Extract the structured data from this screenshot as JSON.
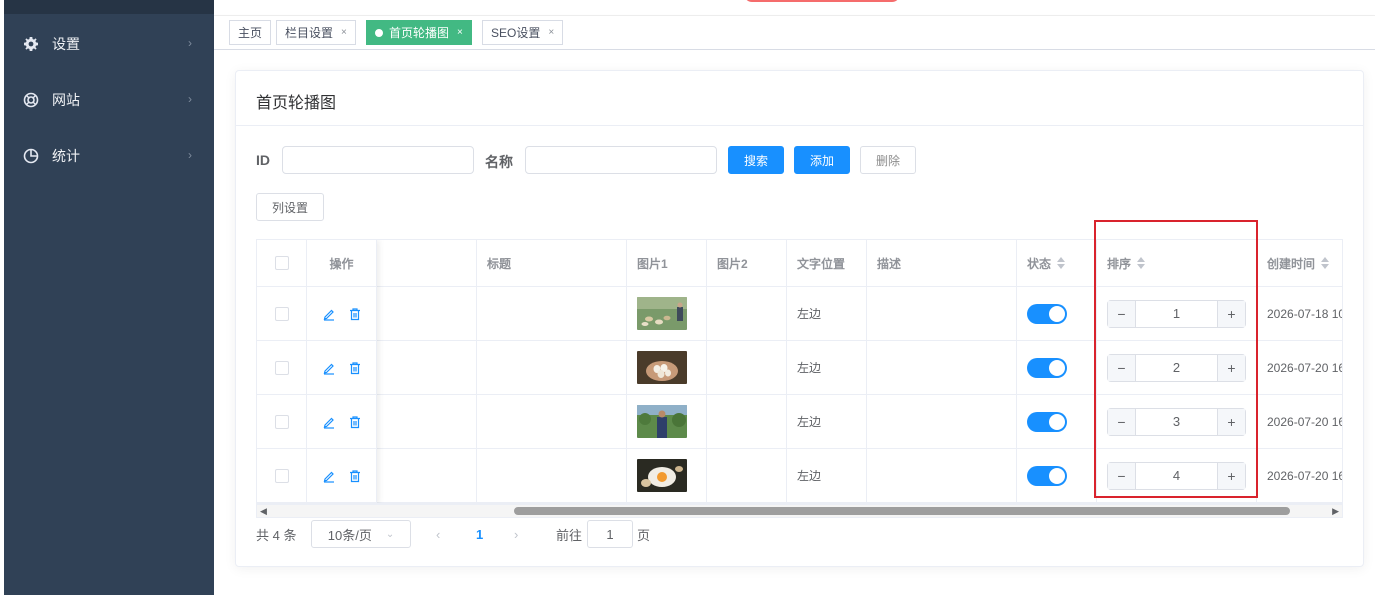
{
  "sidebar": {
    "items": [
      {
        "label": "设置",
        "icon": "gear-icon"
      },
      {
        "label": "网站",
        "icon": "lifebuoy-icon"
      },
      {
        "label": "统计",
        "icon": "pie-chart-icon"
      }
    ]
  },
  "tabs": [
    {
      "label": "主页",
      "closable": false,
      "active": false
    },
    {
      "label": "栏目设置",
      "closable": true,
      "active": false
    },
    {
      "label": "首页轮播图",
      "closable": true,
      "active": true
    },
    {
      "label": "SEO设置",
      "closable": true,
      "active": false
    }
  ],
  "tab_close_glyph": "×",
  "card": {
    "title": "首页轮播图"
  },
  "search": {
    "id_label": "ID",
    "name_label": "名称",
    "id_value": "",
    "name_value": "",
    "search_btn": "搜索",
    "add_btn": "添加",
    "delete_btn": "删除",
    "columns_btn": "列设置"
  },
  "table": {
    "headers": {
      "ops": "操作",
      "title": "标题",
      "img1": "图片1",
      "img2": "图片2",
      "text_pos": "文字位置",
      "desc": "描述",
      "status": "状态",
      "sort": "排序",
      "created": "创建时间"
    },
    "rows": [
      {
        "title": "",
        "img1": "chickens-field",
        "img2": "",
        "text_pos": "左边",
        "desc": "",
        "status": true,
        "sort": "1",
        "created": "2026-07-18 10"
      },
      {
        "title": "",
        "img1": "hands-eggs",
        "img2": "",
        "text_pos": "左边",
        "desc": "",
        "status": true,
        "sort": "2",
        "created": "2026-07-20 16"
      },
      {
        "title": "",
        "img1": "farmer-orchard",
        "img2": "",
        "text_pos": "左边",
        "desc": "",
        "status": true,
        "sort": "3",
        "created": "2026-07-20 16"
      },
      {
        "title": "",
        "img1": "cracked-egg",
        "img2": "",
        "text_pos": "左边",
        "desc": "",
        "status": true,
        "sort": "4",
        "created": "2026-07-20 16"
      }
    ],
    "stepper_minus": "−",
    "stepper_plus": "+"
  },
  "pagination": {
    "total": "共 4 条",
    "page_size": "10条/页",
    "current_page": "1",
    "goto_label": "前往",
    "goto_value": "1",
    "page_suffix": "页"
  },
  "colors": {
    "primary": "#1890ff",
    "active_tab": "#42b983",
    "sidebar": "#304156",
    "highlight": "#d9232d"
  }
}
